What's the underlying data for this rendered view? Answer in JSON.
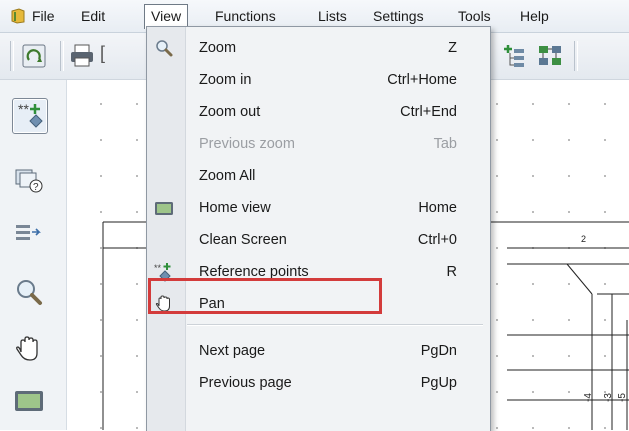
{
  "menubar": {
    "items": [
      "File",
      "Edit",
      "View",
      "Functions",
      "Lists",
      "Settings",
      "Tools",
      "Help"
    ],
    "active": "View"
  },
  "view_menu": {
    "items": [
      {
        "label": "Zoom",
        "shortcut": "Z",
        "icon": "magnifier-icon",
        "enabled": true
      },
      {
        "label": "Zoom in",
        "shortcut": "Ctrl+Home",
        "icon": "",
        "enabled": true
      },
      {
        "label": "Zoom out",
        "shortcut": "Ctrl+End",
        "icon": "",
        "enabled": true
      },
      {
        "label": "Previous zoom",
        "shortcut": "Tab",
        "icon": "",
        "enabled": false
      },
      {
        "label": "Zoom All",
        "shortcut": "",
        "icon": "",
        "enabled": true
      },
      {
        "label": "Home view",
        "shortcut": "Home",
        "icon": "monitor-icon",
        "enabled": true
      },
      {
        "label": "Clean Screen",
        "shortcut": "Ctrl+0",
        "icon": "",
        "enabled": true
      },
      {
        "label": "Reference points",
        "shortcut": "R",
        "icon": "reference-points-icon",
        "enabled": true,
        "highlighted": true
      },
      {
        "label": "Pan",
        "shortcut": "",
        "icon": "hand-icon",
        "enabled": true
      },
      {
        "label": "Next page",
        "shortcut": "PgDn",
        "icon": "",
        "enabled": true
      },
      {
        "label": "Previous page",
        "shortcut": "PgUp",
        "icon": "",
        "enabled": true
      }
    ]
  },
  "canvas": {
    "label_2": "2",
    "vertical_labels": [
      "-4",
      "-3",
      "-5"
    ]
  },
  "colors": {
    "highlight": "#d33b3b",
    "menu_bg": "#f1f3f5",
    "disabled_text": "#9b9ea3"
  }
}
